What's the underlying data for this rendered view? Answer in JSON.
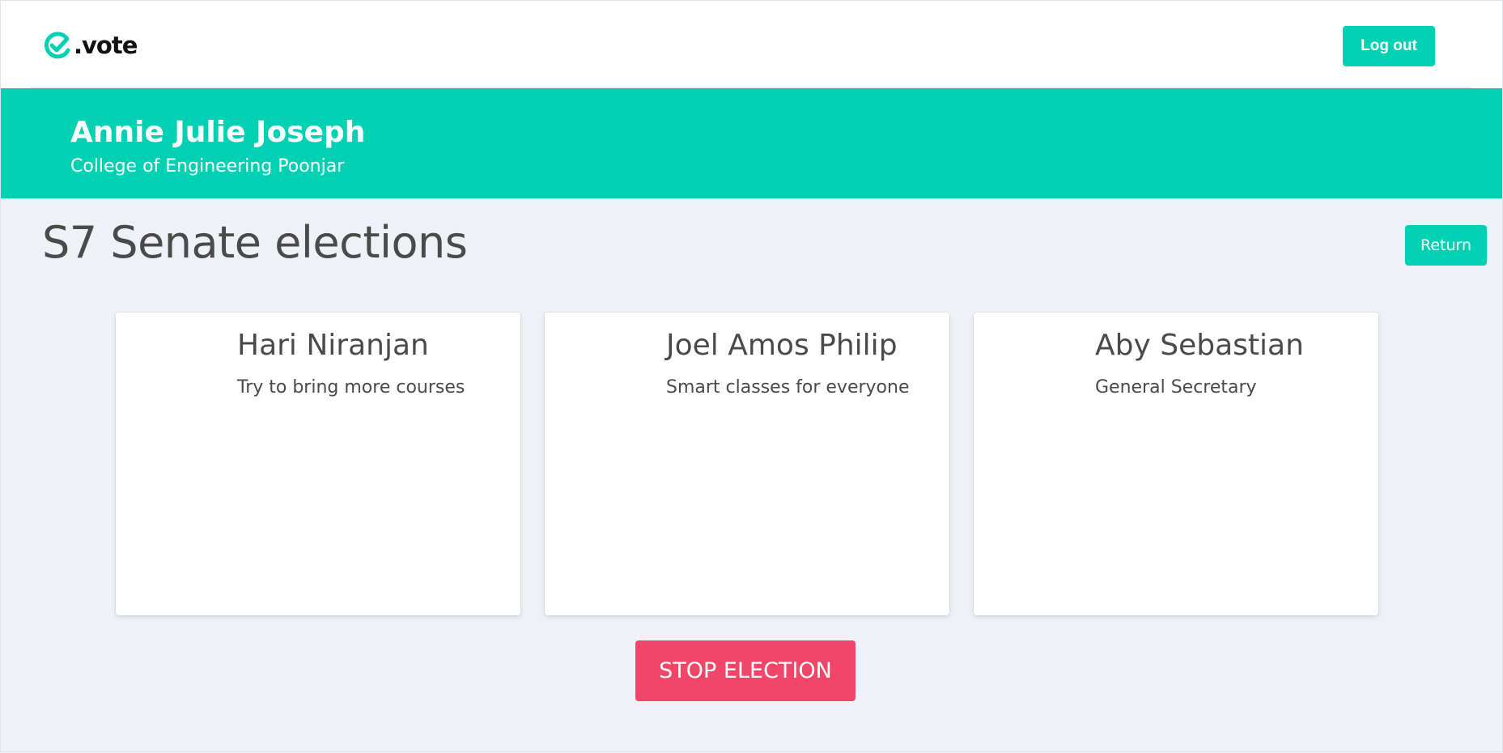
{
  "brand": {
    "logo_text": ".vote",
    "accent_color": "#00d1b2",
    "icon": "checkmark-e-logo-icon"
  },
  "header": {
    "logout_label": "Log out"
  },
  "hero": {
    "user_name": "Annie Julie Joseph",
    "institution": "College of Engineering Poonjar"
  },
  "election": {
    "title": "S7 Senate elections",
    "return_label": "Return",
    "stop_label": "STOP ELECTION",
    "stop_color": "#f14668"
  },
  "candidates": [
    {
      "name": "Hari Niranjan",
      "description": "Try to bring more courses"
    },
    {
      "name": "Joel Amos Philip",
      "description": "Smart classes for everyone"
    },
    {
      "name": "Aby Sebastian",
      "description": "General Secretary"
    }
  ]
}
